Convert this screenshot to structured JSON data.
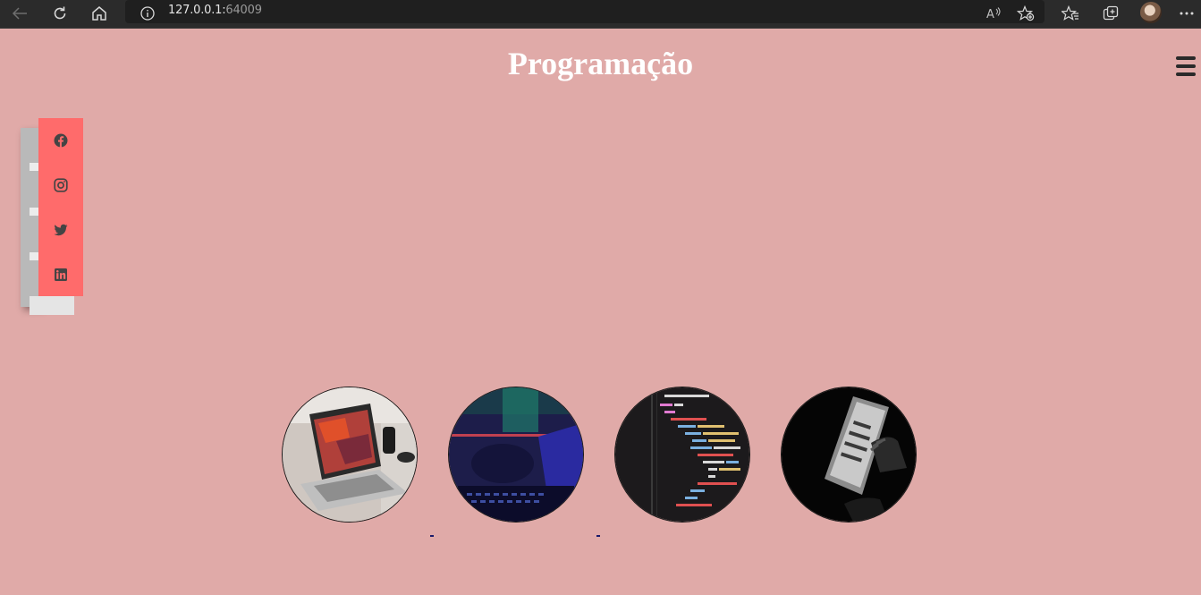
{
  "browser": {
    "url_host": "127.0.0.1:",
    "url_port": "64009"
  },
  "page": {
    "title": "Programação",
    "menu_icon": "hamburger-menu-icon",
    "social": [
      {
        "name": "facebook-icon"
      },
      {
        "name": "instagram-icon"
      },
      {
        "name": "twitter-icon"
      },
      {
        "name": "linkedin-icon"
      }
    ],
    "thumbnails": [
      {
        "name": "laptop-desk-photo"
      },
      {
        "name": "hacker-keyboard-photo"
      },
      {
        "name": "code-screen-photo"
      },
      {
        "name": "hands-laptop-photo"
      }
    ]
  },
  "colors": {
    "background": "#e0aaa8",
    "social_bar": "#ff6b6b",
    "title": "#ffffff"
  }
}
